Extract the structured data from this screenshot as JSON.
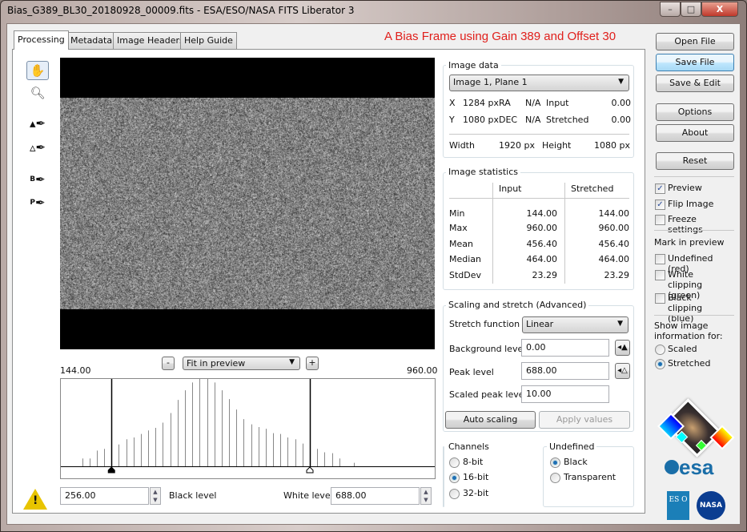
{
  "window": {
    "title": "Bias_G389_BL30_20180928_00009.fits - ESA/ESO/NASA FITS Liberator 3",
    "controls": [
      "–",
      "□",
      "X"
    ]
  },
  "caption": "A Bias Frame using Gain 389 and Offset 30",
  "caption_color": "#e0201c",
  "tabs": [
    {
      "label": "Processing",
      "active": true
    },
    {
      "label": "Metadata"
    },
    {
      "label": "Image Headers"
    },
    {
      "label": "Help Guide"
    }
  ],
  "tools": [
    "hand-icon",
    "zoom-icon",
    "black-level-picker-icon",
    "white-level-picker-icon",
    "background-picker-icon",
    "peak-picker-icon"
  ],
  "tool_letters": {
    "b": "B",
    "p": "P"
  },
  "preview": {
    "zoom_select": "Fit in preview",
    "zoom_out": "-",
    "zoom_in": "+",
    "min_label": "144.00",
    "max_label": "960.00"
  },
  "histogram": {
    "xlim": [
      144,
      960
    ],
    "bins": [
      192,
      208,
      224,
      240,
      256,
      272,
      288,
      304,
      320,
      336,
      352,
      368,
      384,
      400,
      416,
      432,
      448,
      464,
      480,
      496,
      512,
      528,
      544,
      560,
      576,
      592,
      608,
      624,
      640,
      656,
      672,
      688,
      704,
      720,
      736,
      752,
      768,
      784
    ],
    "relative_counts": [
      9,
      9,
      18,
      20,
      25,
      25,
      31,
      33,
      37,
      41,
      44,
      50,
      61,
      76,
      87,
      96,
      100,
      100,
      96,
      87,
      77,
      65,
      54,
      48,
      45,
      43,
      38,
      37,
      33,
      31,
      26,
      21,
      20,
      16,
      15,
      9,
      0,
      4
    ],
    "black_level": 256,
    "white_level": 688
  },
  "levels": {
    "black_value": "256.00",
    "black_label": "Black level",
    "white_label": "White level",
    "white_value": "688.00"
  },
  "image_data": {
    "title": "Image data",
    "plane": "Image 1, Plane 1",
    "x_label": "X",
    "x": "1284 px",
    "ra_label": "RA",
    "ra": "N/A",
    "input_label": "Input",
    "input": "0.00",
    "y_label": "Y",
    "y": "1080 px",
    "dec_label": "DEC",
    "dec": "N/A",
    "stretched_label": "Stretched",
    "stretched": "0.00",
    "width_label": "Width",
    "width": "1920 px",
    "height_label": "Height",
    "height": "1080 px"
  },
  "stats": {
    "title": "Image statistics",
    "col_input": "Input",
    "col_stretched": "Stretched",
    "rows": [
      {
        "label": "Min",
        "input": "144.00",
        "stretched": "144.00"
      },
      {
        "label": "Max",
        "input": "960.00",
        "stretched": "960.00"
      },
      {
        "label": "Mean",
        "input": "456.40",
        "stretched": "456.40"
      },
      {
        "label": "Median",
        "input": "464.00",
        "stretched": "464.00"
      },
      {
        "label": "StdDev",
        "input": "23.29",
        "stretched": "23.29"
      }
    ]
  },
  "scaling": {
    "title": "Scaling and stretch (Advanced)",
    "stretch_label": "Stretch function",
    "stretch": "Linear",
    "bg_label": "Background level",
    "bg": "0.00",
    "peak_label": "Peak level",
    "peak": "688.00",
    "scaled_label": "Scaled peak level",
    "scaled": "10.00",
    "auto": "Auto scaling",
    "apply": "Apply values"
  },
  "channels": {
    "title": "Channels",
    "options": [
      "8-bit",
      "16-bit",
      "32-bit"
    ],
    "selected": "16-bit"
  },
  "undefined": {
    "title": "Undefined",
    "options": [
      "Black",
      "Transparent"
    ],
    "selected": "Black"
  },
  "side": {
    "open": "Open File",
    "save": "Save File",
    "save_edit": "Save & Edit",
    "options": "Options",
    "about": "About",
    "reset": "Reset",
    "preview": "Preview",
    "flip": "Flip Image",
    "freeze": "Freeze settings",
    "mark_title": "Mark in preview",
    "undef_red": "Undefined (red)",
    "white_clip": "White clipping (green)",
    "black_clip": "Black clipping (blue)",
    "show_info": "Show image information for:",
    "scaled": "Scaled",
    "stretched": "Stretched",
    "checks": {
      "preview": true,
      "flip": true,
      "freeze": false,
      "undef_red": false,
      "white_clip": false,
      "black_clip": false
    },
    "show_selected": "Stretched"
  },
  "logos": {
    "esa": "esa",
    "eso": "ES O",
    "nasa": "NASA"
  }
}
